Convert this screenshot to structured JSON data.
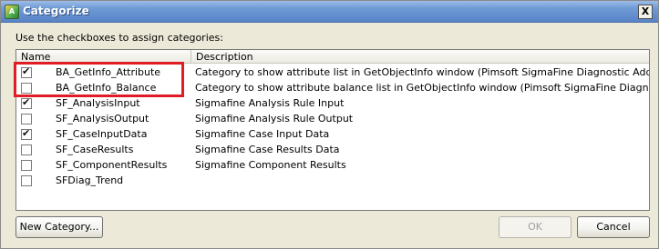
{
  "window": {
    "title": "Categorize",
    "close_glyph": "X"
  },
  "instructions": "Use the checkboxes to assign categories:",
  "columns": {
    "name": "Name",
    "description": "Description"
  },
  "rows": [
    {
      "checked": true,
      "name": "BA_GetInfo_Attribute",
      "description": "Category to show attribute list in GetObjectInfo window (Pimsoft SigmaFine Diagnostic Add-In)"
    },
    {
      "checked": false,
      "name": "BA_GetInfo_Balance",
      "description": "Category to show attribute balance list in GetObjectInfo window (Pimsoft SigmaFine Diagnostic Add"
    },
    {
      "checked": true,
      "name": "SF_AnalysisInput",
      "description": "Sigmafine Analysis Rule Input"
    },
    {
      "checked": false,
      "name": "SF_AnalysisOutput",
      "description": "Sigmafine Analysis Rule Output"
    },
    {
      "checked": true,
      "name": "SF_CaseInputData",
      "description": "Sigmafine Case Input Data"
    },
    {
      "checked": false,
      "name": "SF_CaseResults",
      "description": "Sigmafine Case Results Data"
    },
    {
      "checked": false,
      "name": "SF_ComponentResults",
      "description": "Sigmafine Component Results"
    },
    {
      "checked": false,
      "name": "SFDiag_Trend",
      "description": ""
    }
  ],
  "buttons": {
    "new_category": "New Category...",
    "ok": "OK",
    "cancel": "Cancel"
  },
  "colors": {
    "highlight": "#e01c24",
    "titlebar": "#6f9bd6"
  },
  "icons": {
    "app": "app-icon",
    "close": "close-icon",
    "check": "checkmark-icon"
  }
}
